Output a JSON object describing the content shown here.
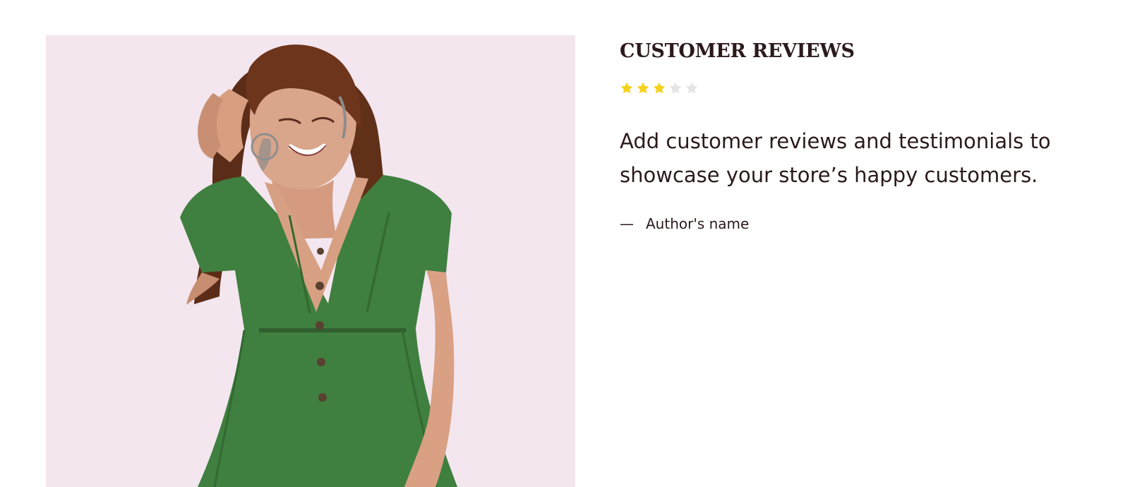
{
  "testimonial": {
    "title": "CUSTOMER REVIEWS",
    "rating": {
      "value": 3,
      "max": 5,
      "filled_color": "#f5d21a",
      "empty_color": "#e5e5e5"
    },
    "quote": "Add customer reviews and testimonials to showcase your store’s happy customers.",
    "author_dash": "—",
    "author_name": "Author's name"
  },
  "image": {
    "subject": "woman in green button-front dress",
    "background_color": "#f3e6ef"
  },
  "colors": {
    "text": "#2b1a1c",
    "page_background": "#ffffff"
  }
}
